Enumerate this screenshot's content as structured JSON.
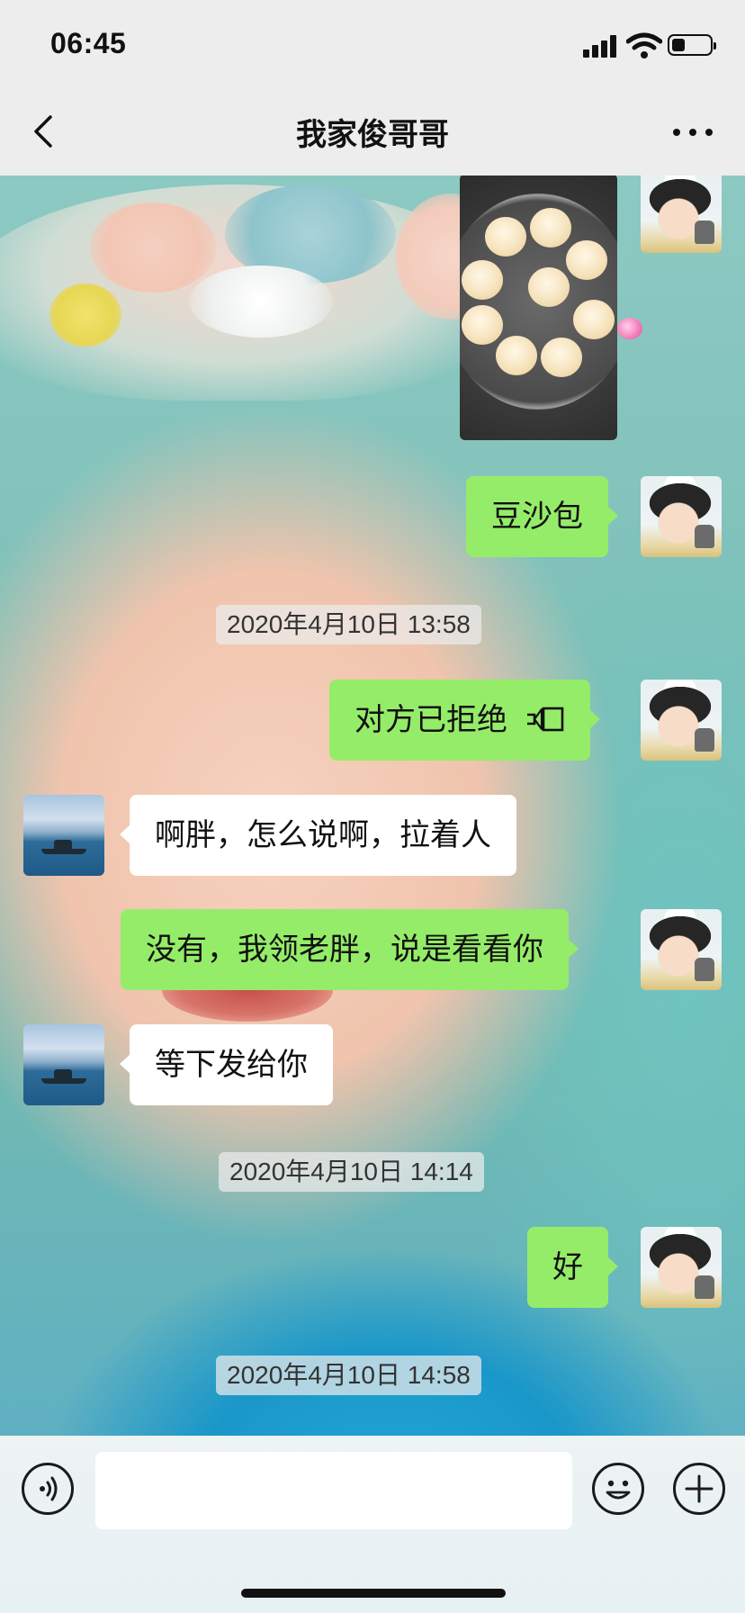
{
  "status_bar": {
    "time": "06:45",
    "icons": [
      "signal-icon",
      "wifi-icon",
      "battery-icon"
    ]
  },
  "nav": {
    "title": "我家俊哥哥",
    "back_icon": "chevron-left-icon",
    "more_icon": "more-dots-icon"
  },
  "messages": [
    {
      "type": "image",
      "from": "me",
      "description_icon": "photo-steamed-buns"
    },
    {
      "type": "text",
      "from": "me",
      "text": "豆沙包"
    },
    {
      "type": "timestamp",
      "text": "2020年4月10日 13:58"
    },
    {
      "type": "call",
      "from": "me",
      "text": "对方已拒绝",
      "icon": "voice-call-icon"
    },
    {
      "type": "text",
      "from": "other",
      "text": "啊胖，怎么说啊，拉着人"
    },
    {
      "type": "text",
      "from": "me",
      "text": "没有，我领老胖，说是看看你"
    },
    {
      "type": "text",
      "from": "other",
      "text": "等下发给你"
    },
    {
      "type": "timestamp",
      "text": "2020年4月10日 14:14"
    },
    {
      "type": "text",
      "from": "me",
      "text": "好"
    },
    {
      "type": "timestamp",
      "text": "2020年4月10日 14:58"
    }
  ],
  "input_bar": {
    "voice_icon": "voice-input-icon",
    "input_value": "",
    "emoji_icon": "emoji-icon",
    "plus_icon": "plus-icon"
  },
  "colors": {
    "my_bubble": "#95ec69",
    "other_bubble": "#ffffff",
    "bar_bg": "#ededed"
  }
}
